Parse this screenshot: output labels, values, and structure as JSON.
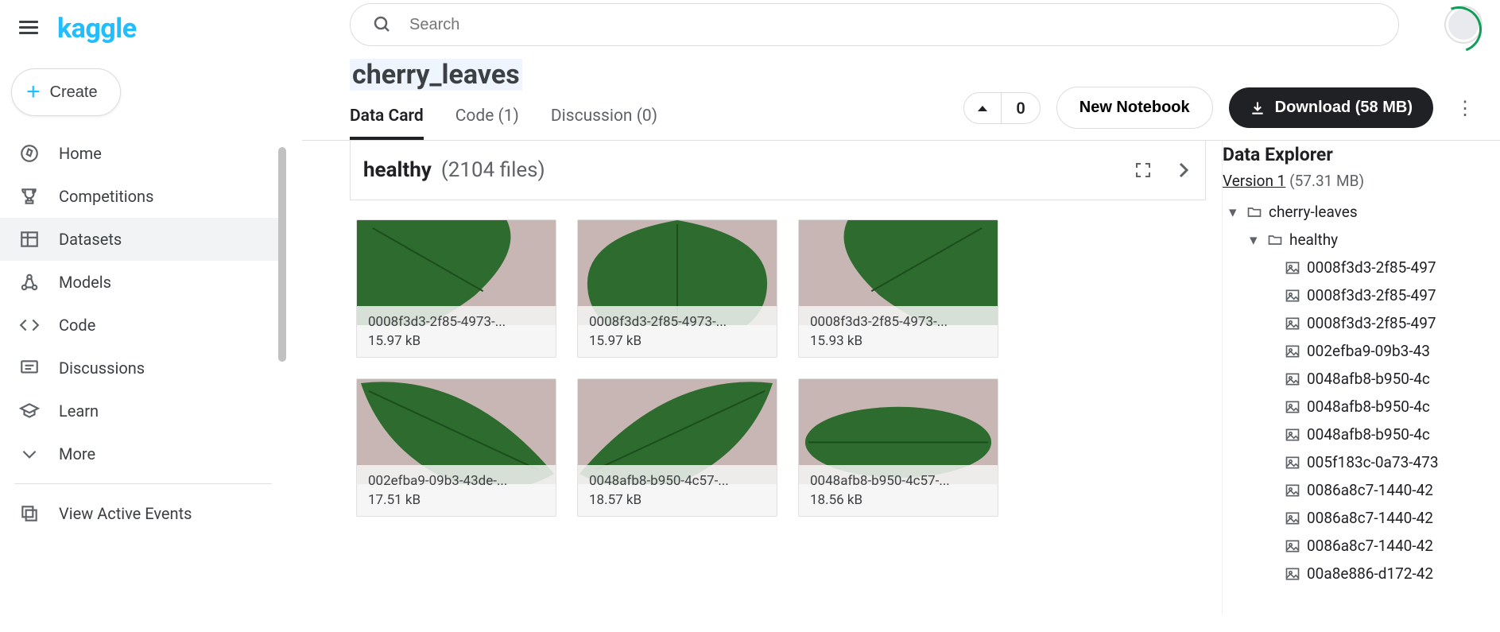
{
  "brand": "kaggle",
  "search": {
    "placeholder": "Search"
  },
  "create_label": "Create",
  "nav": [
    {
      "label": "Home",
      "icon": "compass"
    },
    {
      "label": "Competitions",
      "icon": "trophy"
    },
    {
      "label": "Datasets",
      "icon": "table",
      "active": true
    },
    {
      "label": "Models",
      "icon": "models"
    },
    {
      "label": "Code",
      "icon": "code"
    },
    {
      "label": "Discussions",
      "icon": "discussions"
    },
    {
      "label": "Learn",
      "icon": "learn"
    },
    {
      "label": "More",
      "icon": "chevron-down"
    }
  ],
  "events_label": "View Active Events",
  "dataset": {
    "title": "cherry_leaves",
    "tabs": [
      {
        "label": "Data Card",
        "active": true
      },
      {
        "label": "Code (1)"
      },
      {
        "label": "Discussion (0)"
      }
    ],
    "vote_count": "0",
    "new_notebook_label": "New Notebook",
    "download_label": "Download (58 MB)"
  },
  "folder": {
    "name": "healthy",
    "count_label": "(2104 files)"
  },
  "thumbnails": [
    {
      "name": "0008f3d3-2f85-4973-...",
      "size": "15.97 kB"
    },
    {
      "name": "0008f3d3-2f85-4973-...",
      "size": "15.97 kB"
    },
    {
      "name": "0008f3d3-2f85-4973-...",
      "size": "15.93 kB"
    },
    {
      "name": "002efba9-09b3-43de-...",
      "size": "17.51 kB"
    },
    {
      "name": "0048afb8-b950-4c57-...",
      "size": "18.57 kB"
    },
    {
      "name": "0048afb8-b950-4c57-...",
      "size": "18.56 kB"
    }
  ],
  "explorer": {
    "title": "Data Explorer",
    "version_label": "Version 1",
    "size_label": "(57.31 MB)",
    "root": "cherry-leaves",
    "sub": "healthy",
    "files": [
      "0008f3d3-2f85-497",
      "0008f3d3-2f85-497",
      "0008f3d3-2f85-497",
      "002efba9-09b3-43",
      "0048afb8-b950-4c",
      "0048afb8-b950-4c",
      "0048afb8-b950-4c",
      "005f183c-0a73-473",
      "0086a8c7-1440-42",
      "0086a8c7-1440-42",
      "0086a8c7-1440-42",
      "00a8e886-d172-42"
    ]
  }
}
